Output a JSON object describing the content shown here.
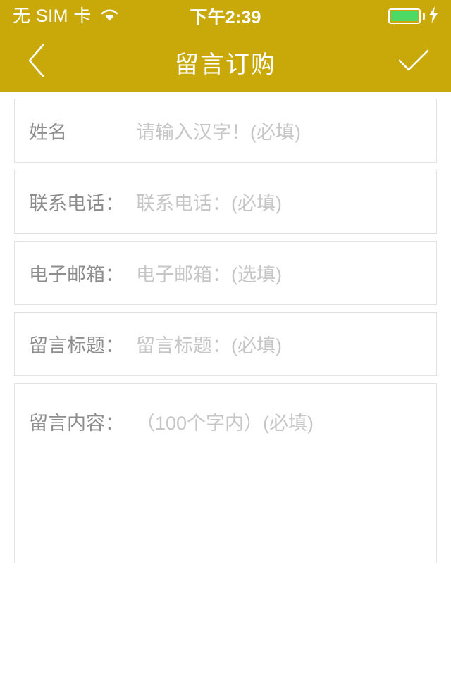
{
  "status_bar": {
    "carrier": "无 SIM 卡",
    "wifi_icon": "wifi-icon",
    "time": "下午2:39",
    "battery_icon": "battery-full-icon",
    "charging_icon": "lightning-bolt-icon"
  },
  "nav_bar": {
    "back_icon": "chevron-left-icon",
    "title": "留言订购",
    "confirm_icon": "checkmark-icon",
    "background_color": "#c9a80a",
    "text_color": "#ffffff"
  },
  "form": {
    "fields": [
      {
        "name": "full-name",
        "label": "姓名",
        "placeholder": "请输入汉字！(必填)",
        "value": "",
        "type": "text",
        "required": true
      },
      {
        "name": "contact-phone",
        "label": "联系电话：",
        "placeholder": "联系电话：(必填)",
        "value": "",
        "type": "tel",
        "required": true
      },
      {
        "name": "email",
        "label": "电子邮箱：",
        "placeholder": "电子邮箱：(选填)",
        "value": "",
        "type": "email",
        "required": false
      },
      {
        "name": "message-title",
        "label": "留言标题：",
        "placeholder": "留言标题：(必填)",
        "value": "",
        "type": "text",
        "required": true
      },
      {
        "name": "message-content",
        "label": "留言内容：",
        "placeholder": "（100个字内）(必填)",
        "value": "",
        "type": "textarea",
        "required": true
      }
    ],
    "label_color": "#8d8d8d",
    "placeholder_color": "#c6c6c6",
    "border_color": "#e2e2e2"
  }
}
